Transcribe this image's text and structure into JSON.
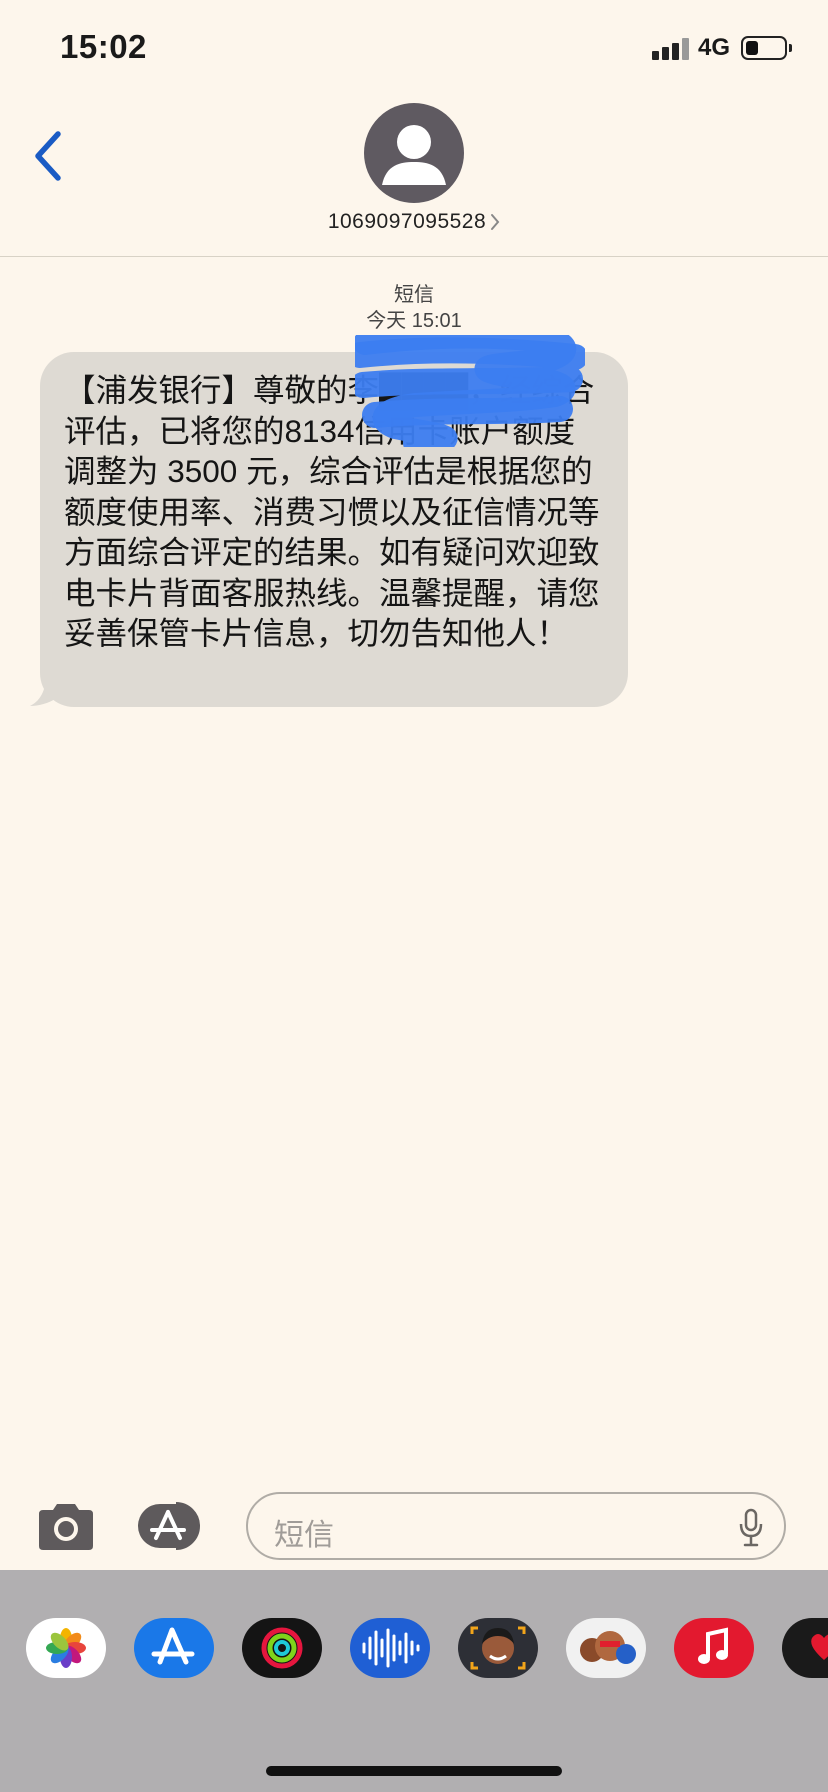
{
  "status_bar": {
    "time": "15:02",
    "network": "4G",
    "battery_level": 0.35
  },
  "header": {
    "contact": "1069097095528"
  },
  "conversation": {
    "service": "短信",
    "timestamp": "今天 15:01"
  },
  "message": {
    "text": "【浦发银行】尊敬的李████，经综合评估，已将您的8134信用卡账户额度调整为 3500 元，综合评估是根据您的额度使用率、消费习惯以及征信情况等方面综合评定的结果。如有疑问欢迎致电卡片背面客服热线。温馨提醒，请您妥善保管卡片信息，切勿告知他人！"
  },
  "compose": {
    "placeholder": "短信"
  },
  "app_drawer": {
    "apps": [
      "photos-app-icon",
      "app-store-icon",
      "activity-icon",
      "audio-message-icon",
      "memoji-icon",
      "memoji-stickers-icon",
      "music-icon",
      "digital-touch-icon"
    ]
  },
  "colors": {
    "accent": "#1a5bc4",
    "bubble": "#dedad3",
    "background": "#fdf6ec",
    "redaction": "#3c7df0"
  }
}
